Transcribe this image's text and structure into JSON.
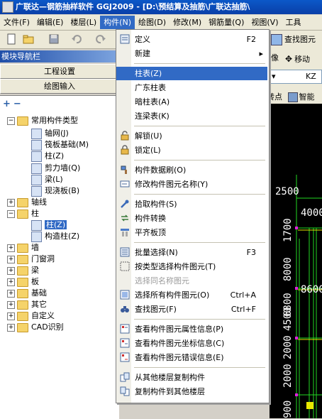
{
  "title": "广联达—钢筋抽样软件 GGJ2009 - [D:\\预结算及抽筋\\广联达抽筋\\",
  "menubar": {
    "items": [
      "文件(F)",
      "编辑(E)",
      "楼层(L)",
      "构件(N)",
      "绘图(D)",
      "修改(M)",
      "钢筋量(Q)",
      "视图(V)",
      "工具"
    ]
  },
  "toolbar": {
    "find_label": "查找图元",
    "move_label": "移动",
    "kz_text": "KZ",
    "point_label": "转点",
    "smart_label": "智能"
  },
  "nav": {
    "title": "模块导航栏",
    "project_settings": "工程设置",
    "draw_input": "绘图输入"
  },
  "tree": {
    "common": "常用构件类型",
    "axis_grid": "轴网(J)",
    "raft": "筏板基础(M)",
    "column_common": "柱(Z)",
    "shear_wall": "剪力墙(Q)",
    "beam": "梁(L)",
    "slab_cast": "现浇板(B)",
    "axis_line": "轴线",
    "column_group": "柱",
    "column_child": "柱(Z)",
    "tie_column": "构造柱(Z)",
    "wall": "墙",
    "door_window": "门窗洞",
    "beam_group": "梁",
    "slab": "板",
    "foundation": "基础",
    "other": "其它",
    "custom": "自定义",
    "cad": "CAD识别"
  },
  "dropdown": {
    "define": "定义",
    "define_sc": "F2",
    "new": "新建",
    "column_table": "柱表(Z)",
    "guangdong_column_table": "广东柱表",
    "hidden_column_table": "暗柱表(A)",
    "link_beam_table": "连梁表(K)",
    "unlock": "解锁(U)",
    "lock": "锁定(L)",
    "refresh": "构件数据刷(O)",
    "rename": "修改构件图元名称(Y)",
    "pick": "拾取构件(S)",
    "convert": "构件转换",
    "flush_top": "平齐板顶",
    "batch_select": "批量选择(N)",
    "batch_select_sc": "F3",
    "select_by_type": "按类型选择构件图元(T)",
    "select_same_name": "选择同名称图元",
    "select_all": "选择所有构件图元(O)",
    "select_all_sc": "Ctrl+A",
    "find": "查找图元(F)",
    "find_sc": "Ctrl+F",
    "view_props": "查看构件图元属性信息(P)",
    "view_coords": "查看构件图元坐标信息(C)",
    "view_errors": "查看构件图元错误信息(E)",
    "copy_from": "从其他楼层复制构件",
    "copy_to": "复制构件到其他楼层"
  },
  "cad": {
    "labels": [
      "2500",
      "4000",
      "1700",
      "8600",
      "8000",
      "6800",
      "2000",
      "4500",
      "900",
      "2000"
    ]
  },
  "colors": {
    "menu_highlight": "#316ac5",
    "title_bar": "#0a3fa8",
    "cad_green": "#22d822",
    "cad_magenta": "#e020e0"
  }
}
